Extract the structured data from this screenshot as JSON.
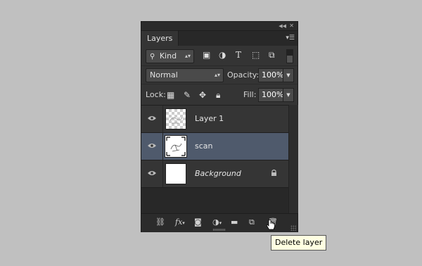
{
  "panel": {
    "tab_label": "Layers",
    "collapse_icon": "double-chevron-left-icon",
    "close_icon": "close-icon",
    "menu_icon": "panel-menu-icon"
  },
  "filter": {
    "kind_label": "Kind",
    "icons": [
      "image-filter-icon",
      "adjustment-filter-icon",
      "type-filter-icon",
      "shape-filter-icon",
      "smart-object-filter-icon"
    ]
  },
  "blend": {
    "mode": "Normal",
    "opacity_label": "Opacity:",
    "opacity_value": "100%"
  },
  "lock": {
    "label": "Lock:",
    "fill_label": "Fill:",
    "fill_value": "100%"
  },
  "layers": [
    {
      "name": "Layer 1",
      "selected": false,
      "italic": false,
      "locked": false
    },
    {
      "name": "scan",
      "selected": true,
      "italic": false,
      "locked": false
    },
    {
      "name": "Background",
      "selected": false,
      "italic": true,
      "locked": true
    }
  ],
  "bottom_icons": [
    "link-icon",
    "fx-icon",
    "mask-icon",
    "adjustment-layer-icon",
    "group-folder-icon",
    "new-layer-icon",
    "trash-icon"
  ],
  "bottom": {
    "fx_label": "fx"
  },
  "tooltip": {
    "text": "Delete layer"
  }
}
